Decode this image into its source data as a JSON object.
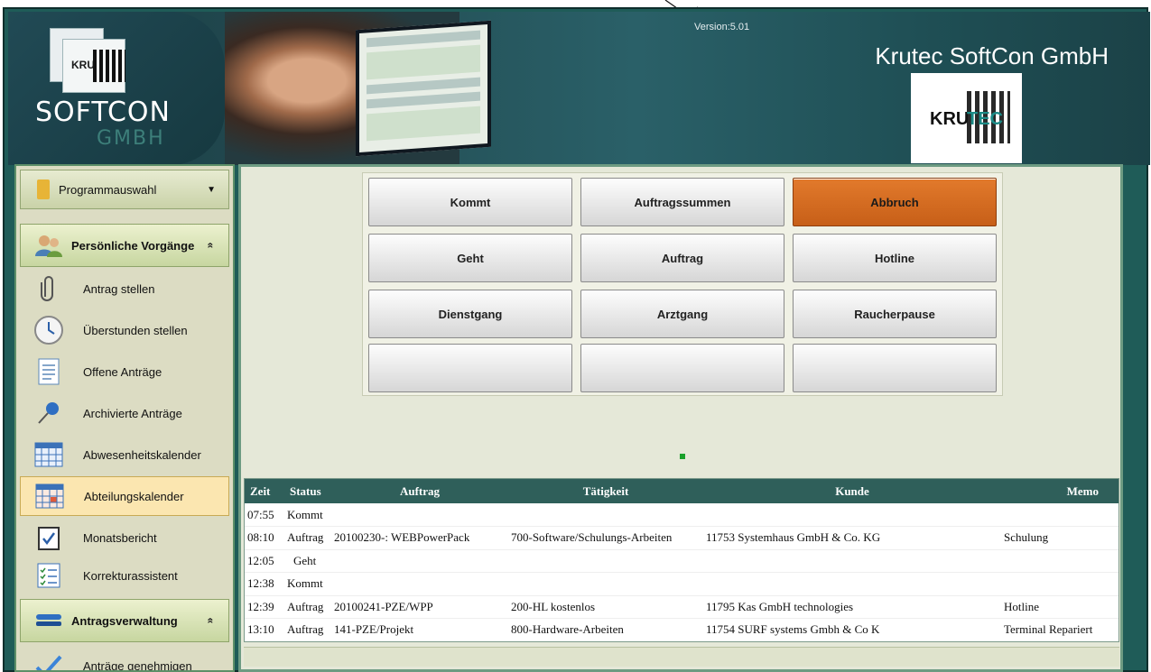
{
  "header": {
    "version": "Version:5.01",
    "company": "Krutec SoftCon GmbH",
    "logo_left": {
      "kru": "KRU",
      "softcon": "SOFTCON",
      "gmbh": "GMBH"
    },
    "logo_right": {
      "kru": "KRU",
      "tec": "TEC"
    }
  },
  "sidebar": {
    "program_select": "Programmauswahl",
    "section_personal": {
      "label": "Persönliche Vorgänge",
      "chevron": "«"
    },
    "personal_items": [
      {
        "label": "Antrag stellen",
        "icon": "paperclip-icon"
      },
      {
        "label": "Überstunden stellen",
        "icon": "clock-icon"
      },
      {
        "label": "Offene Anträge",
        "icon": "document-list-icon"
      },
      {
        "label": "Archivierte Anträge",
        "icon": "pushpin-icon"
      },
      {
        "label": "Abwesenheitskalender",
        "icon": "calendar-icon"
      },
      {
        "label": "Abteilungskalender",
        "icon": "calendar-icon"
      },
      {
        "label": "Monatsbericht",
        "icon": "clipboard-check-icon"
      },
      {
        "label": "Korrekturassistent",
        "icon": "checklist-icon"
      }
    ],
    "section_admin": {
      "label": "Antragsverwaltung",
      "chevron": "«"
    },
    "admin_items": [
      {
        "label": "Anträge genehmigen",
        "icon": "checkmark-icon"
      }
    ]
  },
  "buttons": [
    [
      "Kommt",
      "Auftragssummen",
      "Abbruch"
    ],
    [
      "Geht",
      "Auftrag",
      "Hotline"
    ],
    [
      "Dienstgang",
      "Arztgang",
      "Raucherpause"
    ],
    [
      "",
      "",
      ""
    ]
  ],
  "colors": {
    "abort_button": "#d16a22",
    "table_header": "#2f5f5a",
    "status_dot": "#1aa02a"
  },
  "table": {
    "columns": [
      "Zeit",
      "Status",
      "Auftrag",
      "Tätigkeit",
      "Kunde",
      "Memo"
    ],
    "rows": [
      [
        "07:55",
        "Kommt",
        "",
        "",
        "",
        ""
      ],
      [
        "08:10",
        "Auftrag",
        "20100230-: WEBPowerPack",
        "700-Software/Schulungs-Arbeiten",
        "11753 Systemhaus GmbH & Co. KG",
        "Schulung"
      ],
      [
        "12:05",
        "Geht",
        "",
        "",
        "",
        ""
      ],
      [
        "12:38",
        "Kommt",
        "",
        "",
        "",
        ""
      ],
      [
        "12:39",
        "Auftrag",
        "20100241-PZE/WPP",
        "200-HL kostenlos",
        "11795 Kas GmbH technologies",
        "Hotline"
      ],
      [
        "13:10",
        "Auftrag",
        "141-PZE/Projekt",
        "800-Hardware-Arbeiten",
        "11754 SURF systems Gmbh & Co K",
        "Terminal Repariert"
      ]
    ]
  }
}
